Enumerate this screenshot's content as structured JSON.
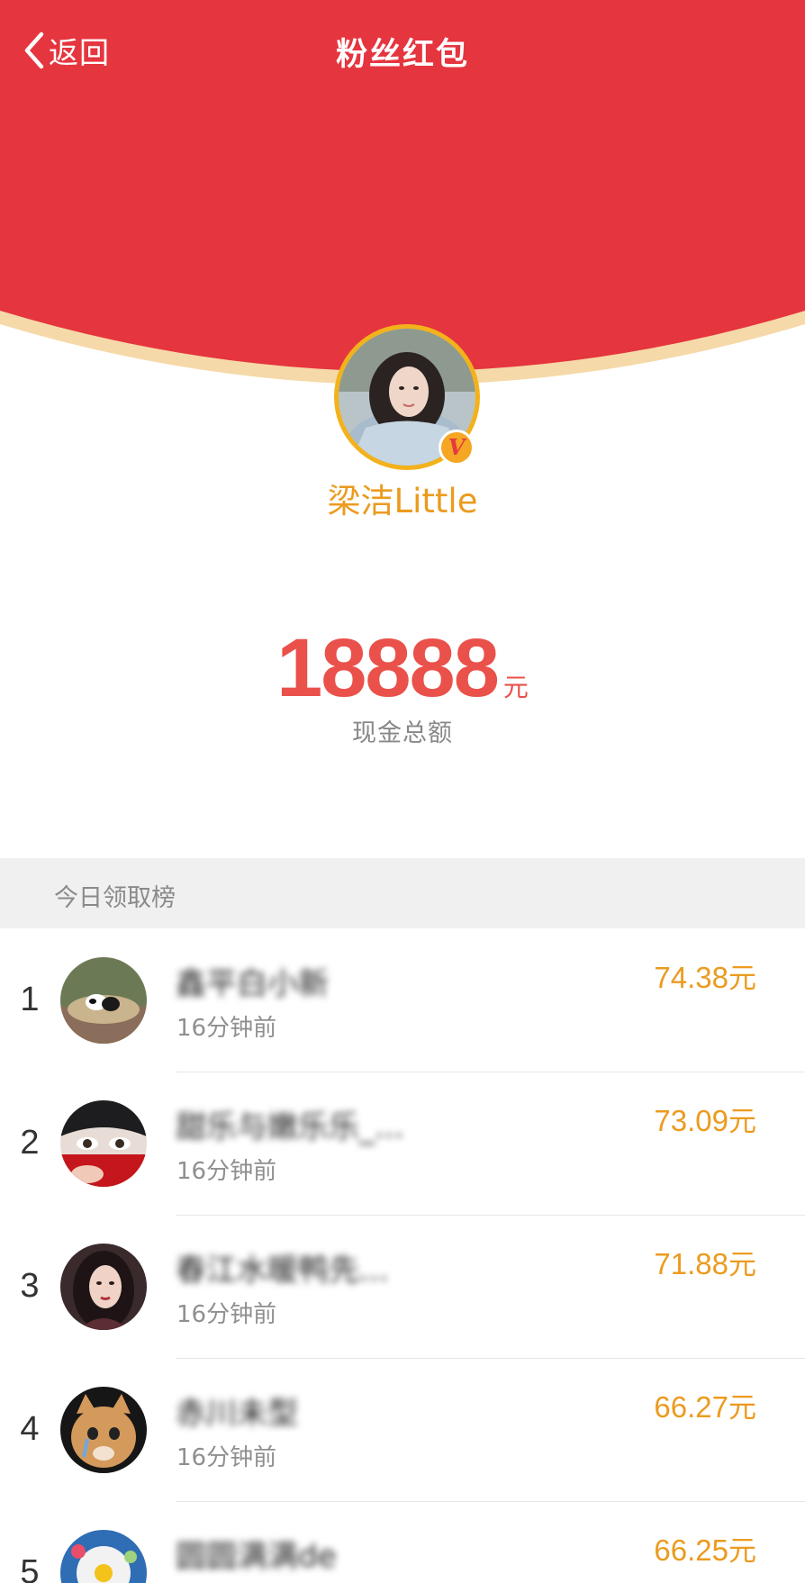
{
  "nav": {
    "back_label": "返回",
    "title": "粉丝红包"
  },
  "colors": {
    "header_red": "#e5353f",
    "gold": "#eb9b1f",
    "amount_red": "#e9514a"
  },
  "profile": {
    "name": "梁洁Little",
    "verified_icon": "v-verified-badge"
  },
  "total": {
    "amount": "18888",
    "unit": "元",
    "label": "现金总额"
  },
  "leaderboard": {
    "title": "今日领取榜",
    "rows": [
      {
        "rank": "1",
        "name": "鑫平白小新",
        "time": "16分钟前",
        "money": "74.38",
        "unit": "元"
      },
      {
        "rank": "2",
        "name": "甜乐与嫩乐乐_...",
        "time": "16分钟前",
        "money": "73.09",
        "unit": "元"
      },
      {
        "rank": "3",
        "name": "春江水暖鸭先...",
        "time": "16分钟前",
        "money": "71.88",
        "unit": "元"
      },
      {
        "rank": "4",
        "name": "赤川未型",
        "time": "16分钟前",
        "money": "66.27",
        "unit": "元"
      },
      {
        "rank": "5",
        "name": "圆圆满满de",
        "time": "",
        "money": "66.25",
        "unit": "元"
      }
    ]
  }
}
